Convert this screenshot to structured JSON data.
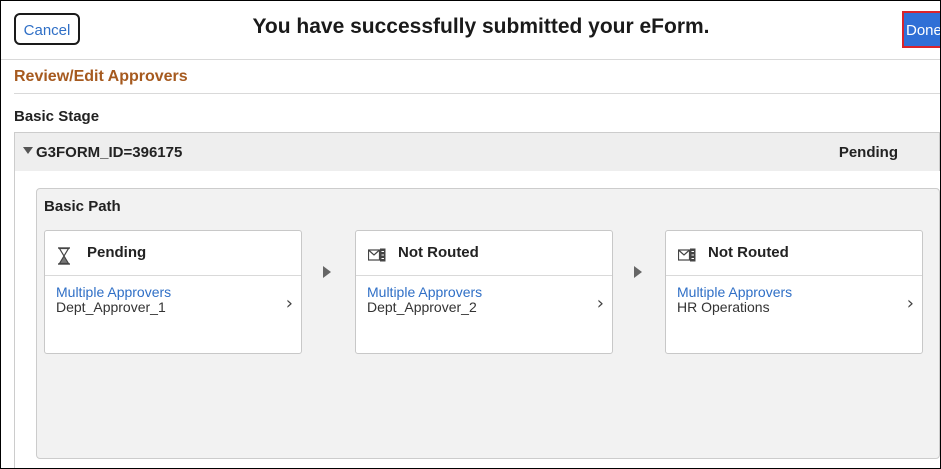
{
  "header": {
    "cancel_label": "Cancel",
    "title": "You have successfully submitted your eForm.",
    "done_label": "Done"
  },
  "section": {
    "title": "Review/Edit Approvers",
    "stage_title": "Basic Stage"
  },
  "stage": {
    "id_label": "G3FORM_ID=396175",
    "status": "Pending",
    "expanded": true
  },
  "path": {
    "title": "Basic Path",
    "steps": [
      {
        "status": "Pending",
        "icon": "hourglass-icon",
        "role": "Multiple Approvers",
        "name": "Dept_Approver_1"
      },
      {
        "status": "Not Routed",
        "icon": "not-routed-icon",
        "role": "Multiple Approvers",
        "name": "Dept_Approver_2"
      },
      {
        "status": "Not Routed",
        "icon": "not-routed-icon",
        "role": "Multiple Approvers",
        "name": "HR Operations"
      }
    ]
  },
  "colors": {
    "link": "#2f6fc6",
    "section_title": "#a65a1f",
    "done_bg": "#2f6fd6",
    "done_border": "#d9232a"
  }
}
